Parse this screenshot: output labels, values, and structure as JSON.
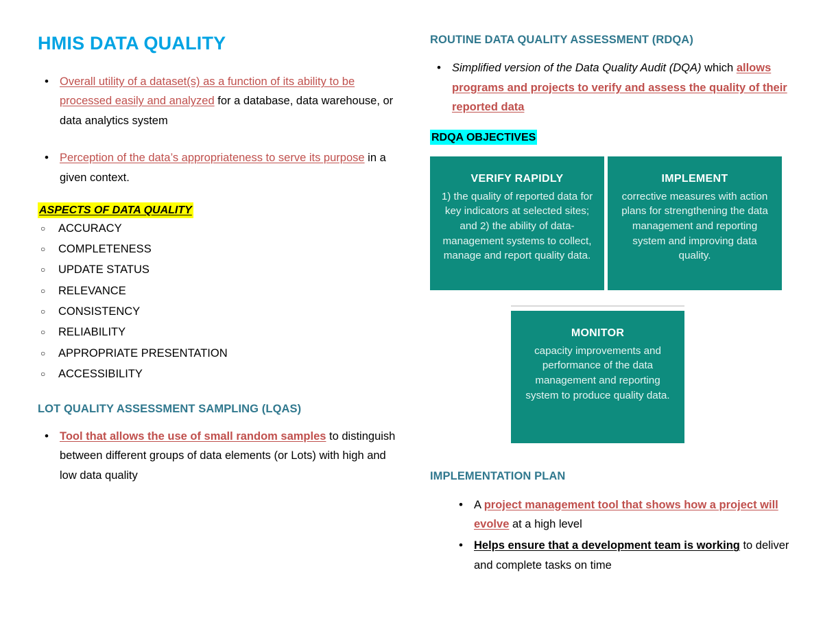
{
  "colors": {
    "title_blue": "#00A3E3",
    "heading_teal": "#30788E",
    "emphasis_red": "#C0504D",
    "box_teal": "#0E8C7E",
    "highlight_yellow": "#FFFF00",
    "highlight_cyan": "#00FFFF"
  },
  "left": {
    "title": "HMIS DATA QUALITY",
    "bullet1": {
      "emph": "Overall utility of a dataset(s) as a function of its ability to be processed easily and analyzed",
      "rest": " for a database, data warehouse, or data analytics system"
    },
    "bullet2": {
      "emph": "Perception of the data’s appropriateness to serve its purpose",
      "rest": " in a given context."
    },
    "aspects_heading": "ASPECTS OF DATA QUALITY",
    "aspects": [
      "ACCURACY",
      "COMPLETENESS",
      "UPDATE STATUS",
      "RELEVANCE",
      "CONSISTENCY",
      "RELIABILITY",
      "APPROPRIATE PRESENTATION",
      "ACCESSIBILITY"
    ],
    "lqas_heading": "LOT QUALITY ASSESSMENT SAMPLING (LQAS)",
    "lqas_bullet": {
      "emph": "Tool that allows the use of small random samples",
      "rest": " to distinguish between different groups of data elements (or Lots) with high and low data quality"
    }
  },
  "right": {
    "rdqa_heading": "ROUTINE DATA QUALITY ASSESSMENT (RDQA)",
    "rdqa_bullet": {
      "italic_lead": "Simplified version of the Data Quality Audit (DQA)",
      "connector": " which ",
      "emph": "allows programs and projects to verify and assess the quality of their reported data"
    },
    "objectives_heading": "RDQA OBJECTIVES",
    "boxes": [
      {
        "title": "VERIFY RAPIDLY",
        "body": "1) the quality of reported data for key indicators at selected sites; and 2) the ability of data-management systems to collect, manage and report quality data."
      },
      {
        "title": "IMPLEMENT",
        "body": "corrective measures with action plans for strengthening the data management and reporting system and improving data quality."
      },
      {
        "title": "MONITOR",
        "body": "capacity improvements and performance of the data management and reporting system to produce quality data."
      }
    ],
    "plan_heading": "IMPLEMENTATION PLAN",
    "plan_bullet1": {
      "lead": "A ",
      "emph": "project management tool that shows how a project will evolve",
      "rest": " at a high level"
    },
    "plan_bullet2": {
      "emph": "Helps ensure that a development team is working",
      "rest": " to deliver and complete tasks on time"
    }
  }
}
